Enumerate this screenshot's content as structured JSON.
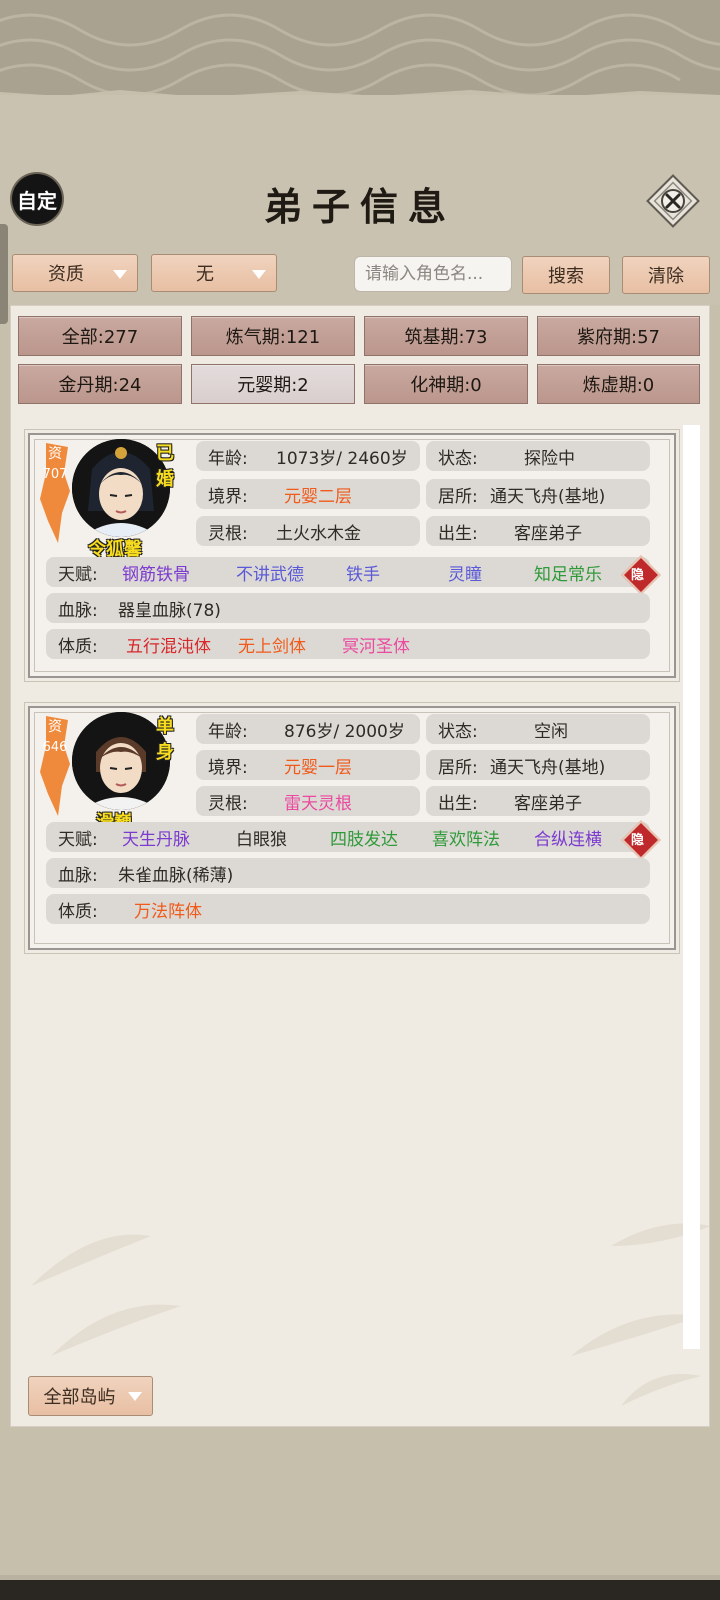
{
  "header": {
    "title": "弟子信息",
    "custom_label": "自定",
    "close_icon": "close-icon"
  },
  "filters": {
    "sort_value": "资质",
    "sub_filter_value": "无",
    "search_placeholder": "请输入角色名...",
    "search_label": "搜索",
    "clear_label": "清除"
  },
  "stats": [
    {
      "label": "全部:277"
    },
    {
      "label": "炼气期:121"
    },
    {
      "label": "筑基期:73"
    },
    {
      "label": "紫府期:57"
    },
    {
      "label": "金丹期:24"
    },
    {
      "label": "元婴期:2"
    },
    {
      "label": "化神期:0"
    },
    {
      "label": "炼虚期:0"
    }
  ],
  "disciples": [
    {
      "name": "令狐馨",
      "marital": "已婚",
      "aptitude_label": "资",
      "aptitude_value": "707",
      "age_label": "年龄:",
      "age": "1073岁/ 2460岁",
      "status_label": "状态:",
      "status": "探险中",
      "realm_label": "境界:",
      "realm": "元婴二层",
      "residence_label": "居所:",
      "residence": "通天飞舟(基地)",
      "root_label": "灵根:",
      "root": "土火水木金",
      "origin_label": "出生:",
      "origin": "客座弟子",
      "talent_label": "天赋:",
      "talents": [
        "钢筋铁骨",
        "不讲武德",
        "铁手",
        "灵瞳",
        "知足常乐"
      ],
      "talent_colors": [
        "#7b3bd0",
        "#5a5ad8",
        "#5a5ad8",
        "#5a5ad8",
        "#2f9a3a"
      ],
      "hide_label": "隐",
      "blood_label": "血脉:",
      "blood": "器皇血脉(78)",
      "body_label": "体质:",
      "bodies": [
        "五行混沌体",
        "无上剑体",
        "冥河圣体"
      ],
      "body_colors": [
        "#d8282a",
        "#f05a1a",
        "#ea4aa0"
      ]
    },
    {
      "name": "滑巍",
      "marital": "单身",
      "aptitude_label": "资",
      "aptitude_value": "646",
      "age_label": "年龄:",
      "age": "876岁/ 2000岁",
      "status_label": "状态:",
      "status": "空闲",
      "realm_label": "境界:",
      "realm": "元婴一层",
      "residence_label": "居所:",
      "residence": "通天飞舟(基地)",
      "root_label": "灵根:",
      "root": "雷天灵根",
      "origin_label": "出生:",
      "origin": "客座弟子",
      "talent_label": "天赋:",
      "talents": [
        "天生丹脉",
        "白眼狼",
        "四肢发达",
        "喜欢阵法",
        "合纵连横"
      ],
      "talent_colors": [
        "#7b3bd0",
        "#2e2a24",
        "#2f9a3a",
        "#2f9a3a",
        "#7b3bd0"
      ],
      "hide_label": "隐",
      "blood_label": "血脉:",
      "blood": "朱雀血脉(稀薄)",
      "body_label": "体质:",
      "bodies": [
        "万法阵体"
      ],
      "body_colors": [
        "#f05a1a"
      ]
    }
  ],
  "footer": {
    "island_label": "全部岛屿"
  }
}
